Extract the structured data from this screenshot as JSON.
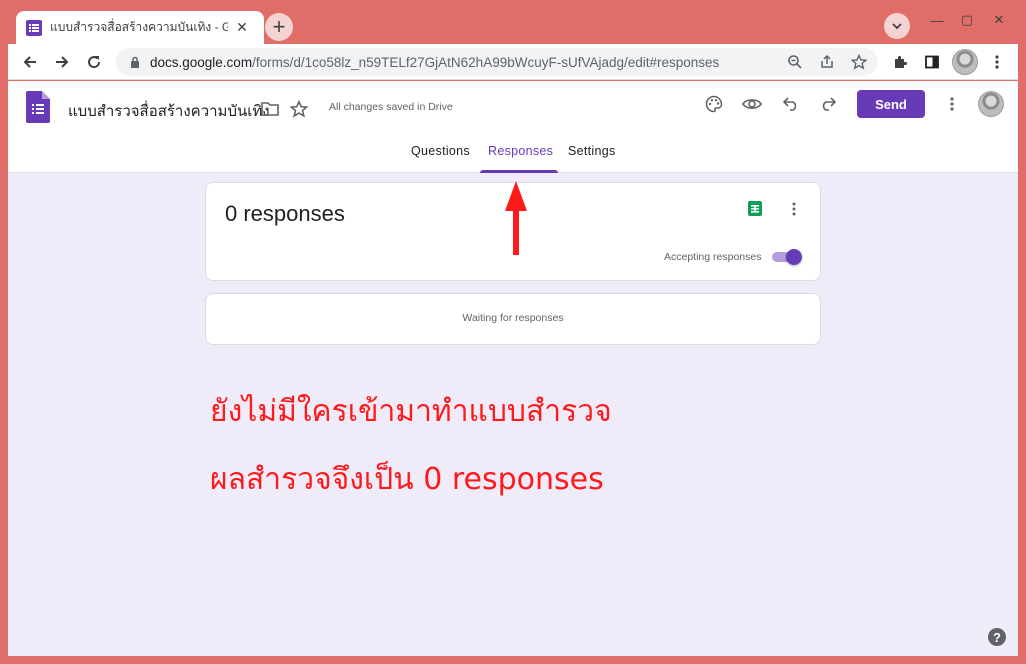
{
  "browser": {
    "tab_title": "แบบสำรวจสื่อสร้างความบันเทิง - Goo",
    "tab_close": "✕",
    "new_tab": "+",
    "window_controls": {
      "minimize": "—",
      "maximize": "▢",
      "close": "✕"
    },
    "url_host": "docs.google.com",
    "url_path": "/forms/d/1co58lz_n59TELf27GjAtN62hA99bWcuyF-sUfVAjadg/edit#responses"
  },
  "form": {
    "title": "แบบสำรวจสื่อสร้างความบันเทิง",
    "saved_status": "All changes saved in Drive",
    "send_label": "Send",
    "tabs": [
      {
        "label": "Questions"
      },
      {
        "label": "Responses"
      },
      {
        "label": "Settings"
      }
    ],
    "active_tab": "Responses",
    "accent_color": "#673ab7"
  },
  "responses": {
    "count_label": "0 responses",
    "accepting_label": "Accepting responses",
    "accepting": true,
    "waiting_label": "Waiting for responses"
  },
  "annotation": {
    "line1": "ยังไม่มีใครเข้ามาทำแบบสำรวจ",
    "line2": "ผลสำรวจจึงเป็น 0 responses",
    "color": "#ff1a1a"
  },
  "help": "?"
}
